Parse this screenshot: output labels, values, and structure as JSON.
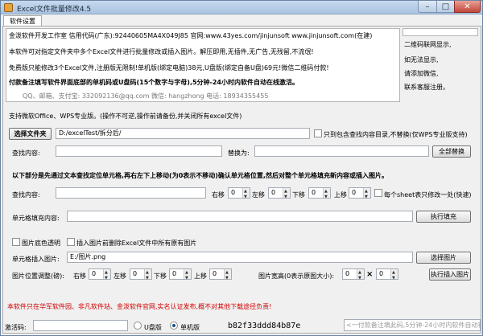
{
  "window": {
    "title": "Excel文件批量修改4.5",
    "min_glyph": "–",
    "max_glyph": "□",
    "close_glyph": "✕"
  },
  "tabs": [
    {
      "label": "软件设置"
    }
  ],
  "info": {
    "line1": "金泼软件开发工作室 信用代码(广东):92440605MA4X049J85 官网:www.43yes.com/jinjunsoft www.jinjunsoft.com(在建)",
    "line2": "本软件可对指定文件夹中多个Excel文件进行批量修改或插入图片。解压即用,无插件,无广告,无残留,不流氓!",
    "line3": "免费版只能修改3个Excel文件,注册版无限制!单机版(绑定电脑)38元,U盘版(绑定自备U盘)69元!微信二维码付款!",
    "line4": "付款备注填写软件界面底部的单机码或U盘码(15个数字与字母),5分钟-24小时内软件自动在线激活。",
    "contact": "QQ、邮箱、支付宝: 332092136@qq.com       微信: hangzhong       电话: 18934355455"
  },
  "qr_side": {
    "line1": "二维码联网显示,",
    "line2": "如无法显示,",
    "line3": "请添加微信,",
    "line4": "联系客服注册。"
  },
  "support_note": "支持微软Office、WPS专业版。(操作不可逆,操作前请备份,并关闭所有excel文件)",
  "folder": {
    "button": "选择文件夹",
    "path": "D:/excelTest/拆分后/",
    "only_include_label": "只到包含查找内容目录,不替换(仅WPS专业版支持)"
  },
  "find": {
    "label": "查找内容:",
    "value": "",
    "replace_label": "替换为:",
    "replace_value": "",
    "replace_all_button": "全部替换"
  },
  "section_note": "以下部分是先通过文本查找定位单元格,再右左下上移动(为0表示不移动)确认单元格位置,然后对整个单元格填充新内容或插入图片。",
  "find2": {
    "label": "查找内容:",
    "value": "",
    "right_label": "右移",
    "right": "0",
    "left_label": "左移",
    "left": "0",
    "down_label": "下移",
    "down": "0",
    "up_label": "上移",
    "up": "0",
    "per_sheet_label": "每个sheet表只修改一处(快速)"
  },
  "fill": {
    "label": "单元格填充内容:",
    "value": "",
    "button": "执行填充"
  },
  "image_opts": {
    "transparent_label": "图片底色透明",
    "delete_before_label": "插入图片前删除Excel文件中所有原有图片"
  },
  "insert": {
    "label": "单元格插入图片:",
    "path": "E:/图片.png",
    "button": "选择图片"
  },
  "position": {
    "label": "图片位置调整(磅):",
    "right_label": "右移",
    "right": "0",
    "left_label": "左移",
    "left": "0",
    "down_label": "下移",
    "down": "0",
    "up_label": "上移",
    "up": "0",
    "size_label": "图片宽高(0表示原图大小):",
    "width": "0",
    "times": "×",
    "height": "0",
    "button": "执行插入图片"
  },
  "warning": "本软件只在华军软件园、非凡软件站、金泼软件官网,实名认证发布,概不对其他下载途径负责!",
  "bottom": {
    "activation_label": "激活码:",
    "activation_value": "",
    "usb_label": "U盘版",
    "standalone_label": "单机版",
    "machine_code": "b82f33ddd84b87e",
    "hint": "<一付款备注填此码,5分钟-24小时内软件自动在线激活"
  }
}
